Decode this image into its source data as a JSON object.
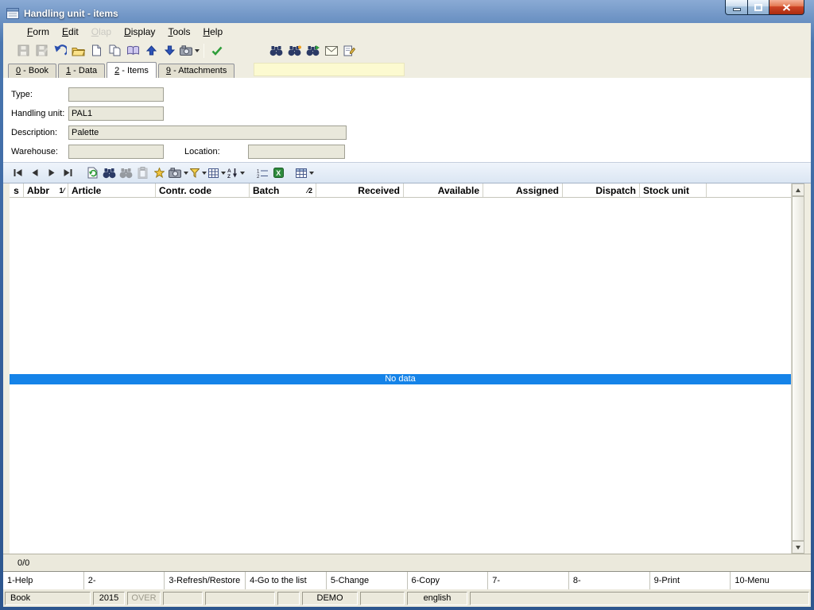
{
  "window": {
    "title": "Handling unit - items"
  },
  "menu": {
    "items": [
      {
        "key": "F",
        "rest": "orm",
        "enabled": true
      },
      {
        "key": "E",
        "rest": "dit",
        "enabled": true
      },
      {
        "key": "O",
        "rest": "lap",
        "enabled": false
      },
      {
        "key": "D",
        "rest": "isplay",
        "enabled": true
      },
      {
        "key": "T",
        "rest": "ools",
        "enabled": true
      },
      {
        "key": "H",
        "rest": "elp",
        "enabled": true
      }
    ]
  },
  "toolbar": {
    "buttons": [
      "save",
      "save-as",
      "undo",
      "open",
      "new",
      "copy",
      "book",
      "move-up",
      "move-down",
      "snapshot",
      "validate",
      "find",
      "find-next",
      "find-goto",
      "mail",
      "notes"
    ]
  },
  "tabs": [
    {
      "key": "0",
      "rest": " - Book",
      "active": false
    },
    {
      "key": "1",
      "rest": " - Data",
      "active": false
    },
    {
      "key": "2",
      "rest": " - Items",
      "active": true
    },
    {
      "key": "9",
      "rest": " - Attachments",
      "active": false
    }
  ],
  "form": {
    "type_label": "Type:",
    "type_value": "",
    "handling_unit_label": "Handling unit:",
    "handling_unit_value": "PAL1",
    "description_label": "Description:",
    "description_value": "Palette",
    "warehouse_label": "Warehouse:",
    "warehouse_value": "",
    "location_label": "Location:",
    "location_value": ""
  },
  "grid": {
    "toolbar_buttons": [
      "first-record",
      "previous-record",
      "next-record",
      "last-record",
      "refresh",
      "find",
      "find-next",
      "paste",
      "insert",
      "snapshot",
      "filter",
      "grid-layout",
      "sort",
      "row-numbers",
      "excel-export",
      "table-view"
    ],
    "columns": [
      {
        "label": "s",
        "sort": ""
      },
      {
        "label": "Abbr",
        "sort": "1⁄"
      },
      {
        "label": "Article",
        "sort": ""
      },
      {
        "label": "Contr. code",
        "sort": ""
      },
      {
        "label": "Batch",
        "sort": "⁄2"
      },
      {
        "label": "Received",
        "sort": ""
      },
      {
        "label": "Available",
        "sort": ""
      },
      {
        "label": "Assigned",
        "sort": ""
      },
      {
        "label": "Dispatch",
        "sort": ""
      },
      {
        "label": "Stock unit",
        "sort": ""
      }
    ],
    "no_data_label": "No data",
    "record_counter": "0/0"
  },
  "function_keys": [
    "1-Help",
    "2-",
    "3-Refresh/Restore",
    "4-Go to the list",
    "5-Change",
    "6-Copy",
    "7-",
    "8-",
    "9-Print",
    "10-Menu"
  ],
  "status_bar": {
    "cells": [
      "Book",
      "2015",
      "OVER",
      "",
      "",
      "",
      "DEMO",
      "",
      "english",
      ""
    ]
  },
  "colors": {
    "no_data_bar": "#1583e8",
    "frame_blue": "#35609c",
    "quick_box_yellow": "#fcfad0",
    "close_button_red": "#cf4526"
  }
}
